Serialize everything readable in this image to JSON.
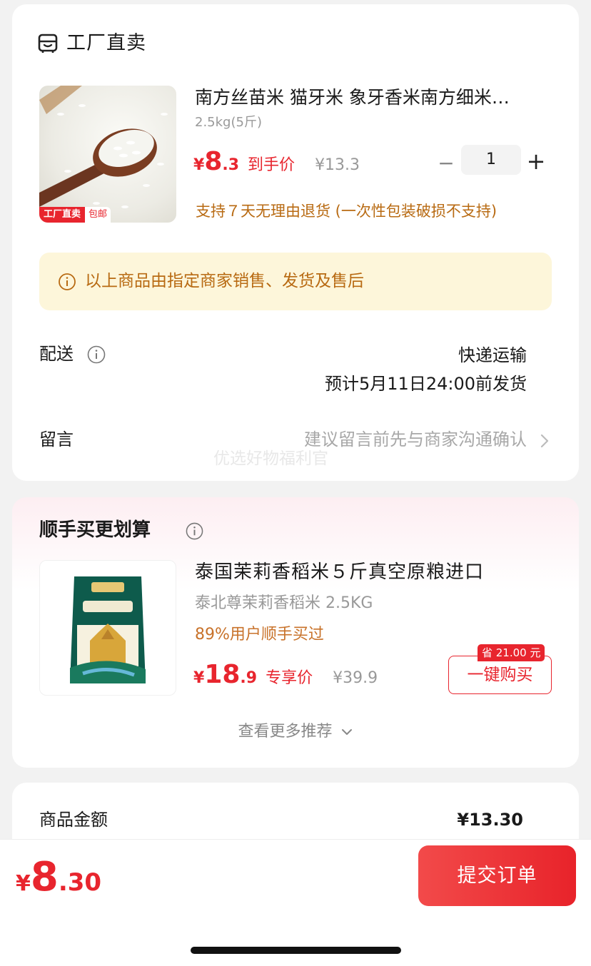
{
  "shop": {
    "name": "工厂直卖",
    "icon": "shop-icon"
  },
  "product": {
    "title": "南方丝苗米 猫牙米 象牙香米南方细米…",
    "spec": "2.5kg(5斤)",
    "currency": "¥",
    "price_int": "8",
    "price_dec": ".3",
    "price_label": "到手价",
    "original_price": "¥13.3",
    "quantity": "1",
    "minus": "−",
    "plus": "+",
    "badge_factory": "工厂直卖",
    "badge_shipping": "包邮",
    "return_note": "支持７天无理由退货 (一次性包装破损不支持)"
  },
  "notice": {
    "text": "以上商品由指定商家销售、发货及售后",
    "icon": "info-icon"
  },
  "shipping": {
    "label": "配送",
    "method": "快递运输",
    "eta": "预计5月11日24:00前发货"
  },
  "message": {
    "label": "留言",
    "hint": "建议留言前先与商家沟通确认"
  },
  "watermark": "优选好物福利官",
  "recommend": {
    "title": "顺手买更划算",
    "name": "泰国茉莉香稻米５斤真空原粮进口",
    "spec": "泰北尊茉莉香稻米 2.5KG",
    "buyers": "89%用户顺手买过",
    "currency": "¥",
    "price_int": "18",
    "price_dec": ".9",
    "price_label": "专享价",
    "original_price": "¥39.9",
    "save_tag": "省 21.00 元",
    "buy_label": "一键购买",
    "more_label": "查看更多推荐"
  },
  "summary": {
    "label": "商品金额",
    "value": "¥13.30"
  },
  "footer": {
    "currency": "¥",
    "total_int": "8",
    "total_dec": ".30",
    "submit_label": "提交订单"
  },
  "colors": {
    "accent": "#e8252e",
    "notice_bg": "#fdf6da",
    "notice_text": "#b86a12"
  }
}
